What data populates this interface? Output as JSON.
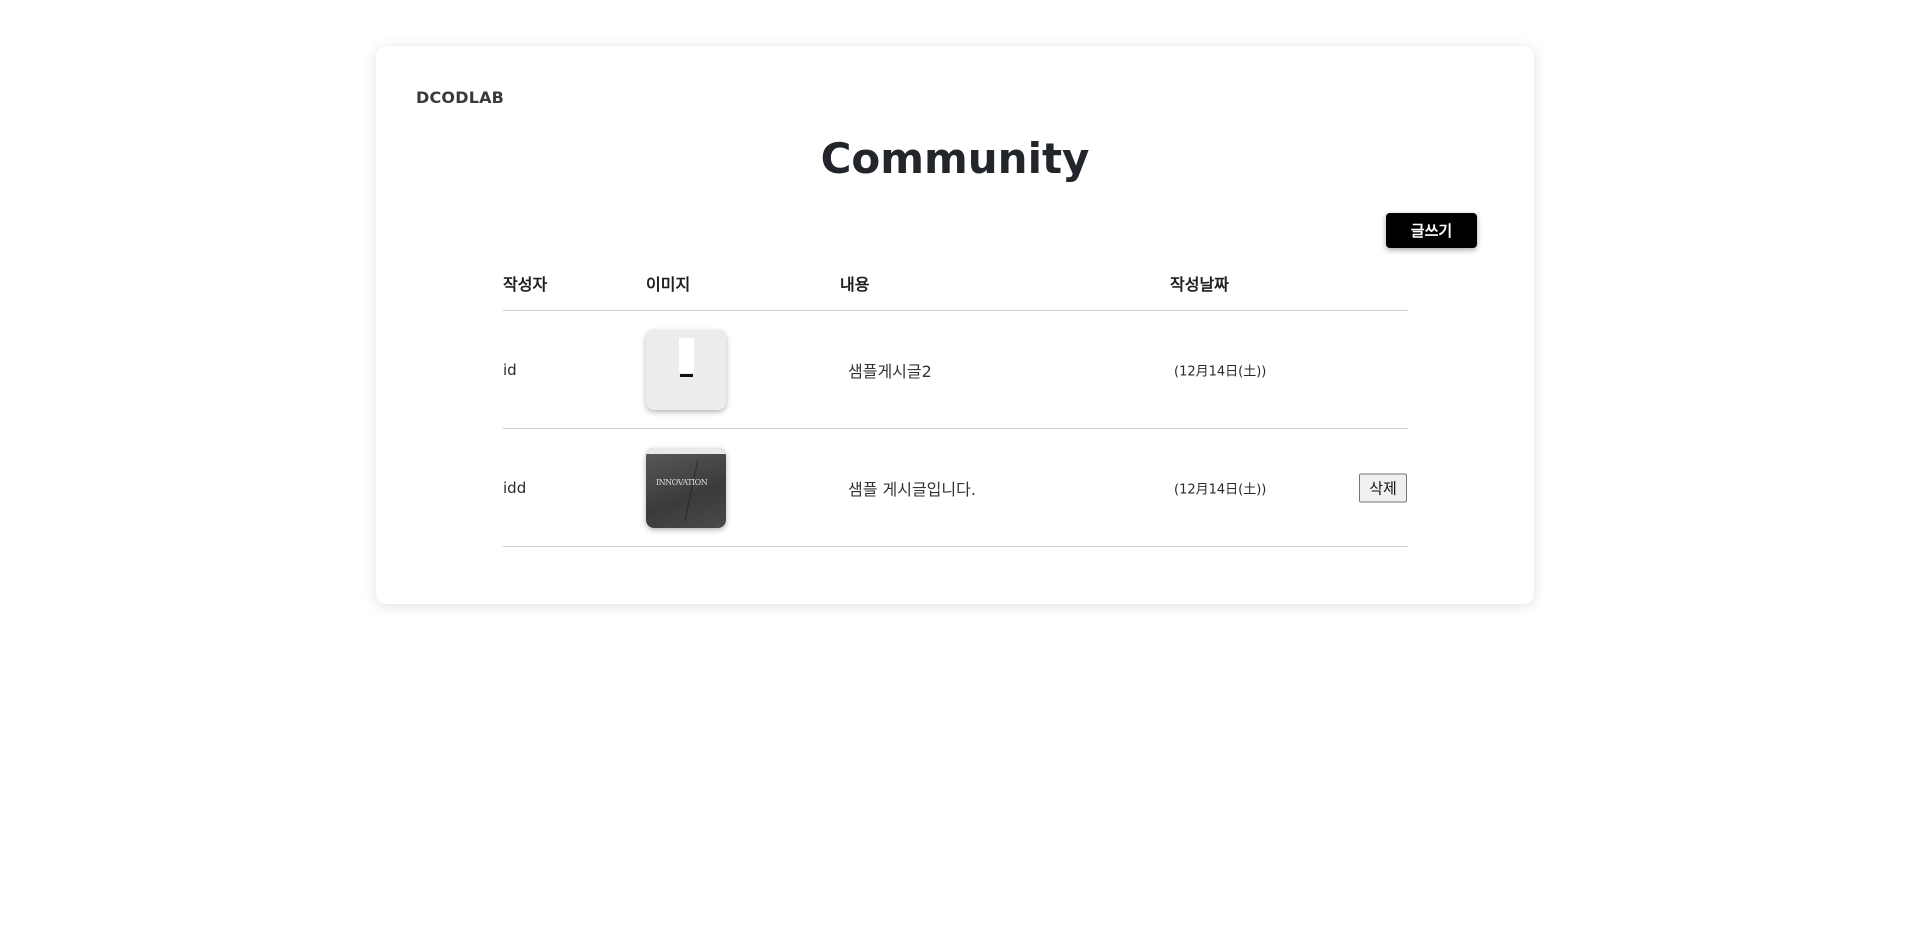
{
  "header": {
    "brand": "DCODLAB",
    "title": "Community",
    "write_label": "글쓰기"
  },
  "table": {
    "columns": [
      "작성자",
      "이미지",
      "내용",
      "작성날짜"
    ],
    "rows": [
      {
        "author": "id",
        "content": "샘플게시글2",
        "date": "(12月14日(土))",
        "thumbnail": "light",
        "delete_label": ""
      },
      {
        "author": "idd",
        "content": "샘플 게시글입니다.",
        "date": "(12月14日(土))",
        "thumbnail": "dark",
        "thumb_text": "INNOVATION",
        "delete_label": "삭제"
      }
    ]
  }
}
